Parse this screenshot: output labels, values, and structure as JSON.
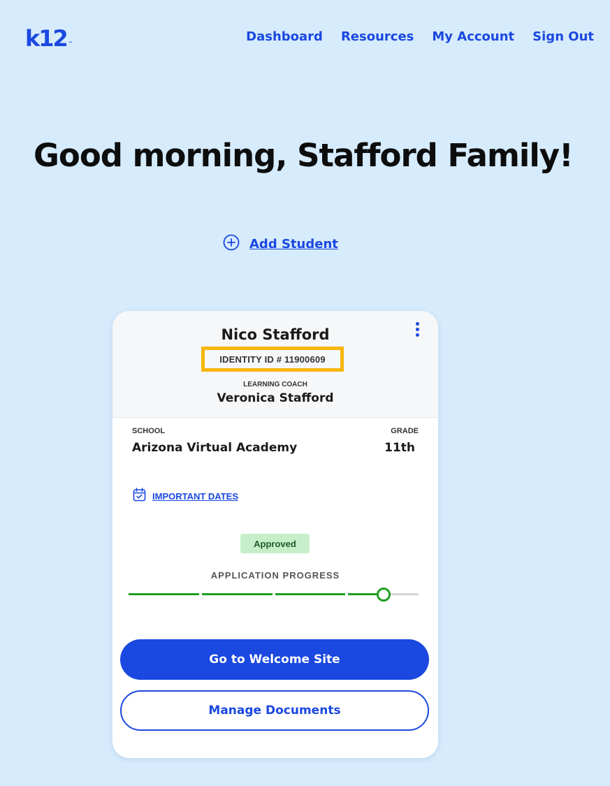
{
  "header": {
    "logo": "k12",
    "logo_tm": "™",
    "nav": [
      "Dashboard",
      "Resources",
      "My Account",
      "Sign Out"
    ]
  },
  "greeting": "Good morning, Stafford Family!",
  "add_student": {
    "label": "Add Student",
    "icon": "plus-circle-icon"
  },
  "student_card": {
    "name": "Nico Stafford",
    "identity": "IDENTITY ID # 11900609",
    "coach_label": "LEARNING COACH",
    "coach_name": "Veronica Stafford",
    "school_label": "SCHOOL",
    "school": "Arizona Virtual Academy",
    "grade_label": "GRADE",
    "grade": "11th",
    "important_dates": {
      "label": "IMPORTANT DATES",
      "icon": "calendar-check-icon"
    },
    "status": "Approved",
    "progress": {
      "label": "APPLICATION PROGRESS",
      "total_steps": 4,
      "completed_steps": 3,
      "current_step_fraction": 0.5
    },
    "primary_button": "Go to Welcome Site",
    "secondary_button": "Manage Documents"
  },
  "colors": {
    "background": "#d6ebfc",
    "brand": "#1a48e0",
    "highlight": "#f6b70c",
    "progress_done": "#1f9e22",
    "progress_todo": "#d4d4d4",
    "badge_bg": "#c6efc9"
  }
}
